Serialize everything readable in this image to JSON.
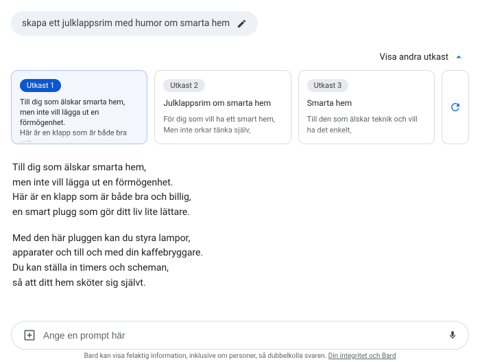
{
  "prompt": "skapa ett julklappsrim med humor om smarta hem",
  "drafts_toggle_label": "Visa andra utkast",
  "drafts": [
    {
      "badge": "Utkast 1",
      "title": "Till dig som älskar smarta hem, men inte vill lägga ut en förmögenhet.\nHär är en klapp som är både bra och",
      "body": ""
    },
    {
      "badge": "Utkast 2",
      "title": "Julklappsrim om smarta hem",
      "body": "För dig som vill ha ett smart hem,\nMen inte orkar tänka själv,"
    },
    {
      "badge": "Utkast 3",
      "title": "Smarta hem",
      "body": "Till den som älskar teknik och vill ha det enkelt,"
    }
  ],
  "answer_p1": "Till dig som älskar smarta hem,\nmen inte vill lägga ut en förmögenhet.\nHär är en klapp som är både bra och billig,\nen smart plugg som gör ditt liv lite lättare.",
  "answer_p2": "Med den här pluggen kan du styra lampor,\napparater och till och med din kaffebryggare.\nDu kan ställa in timers och scheman,\nså att ditt hem sköter sig självt.",
  "input_placeholder": "Ange en prompt här",
  "disclaimer_text": "Bard kan visa felaktig information, inklusive om personer, så dubbelkolla svaren. ",
  "disclaimer_link": "Din integritet och Bard"
}
